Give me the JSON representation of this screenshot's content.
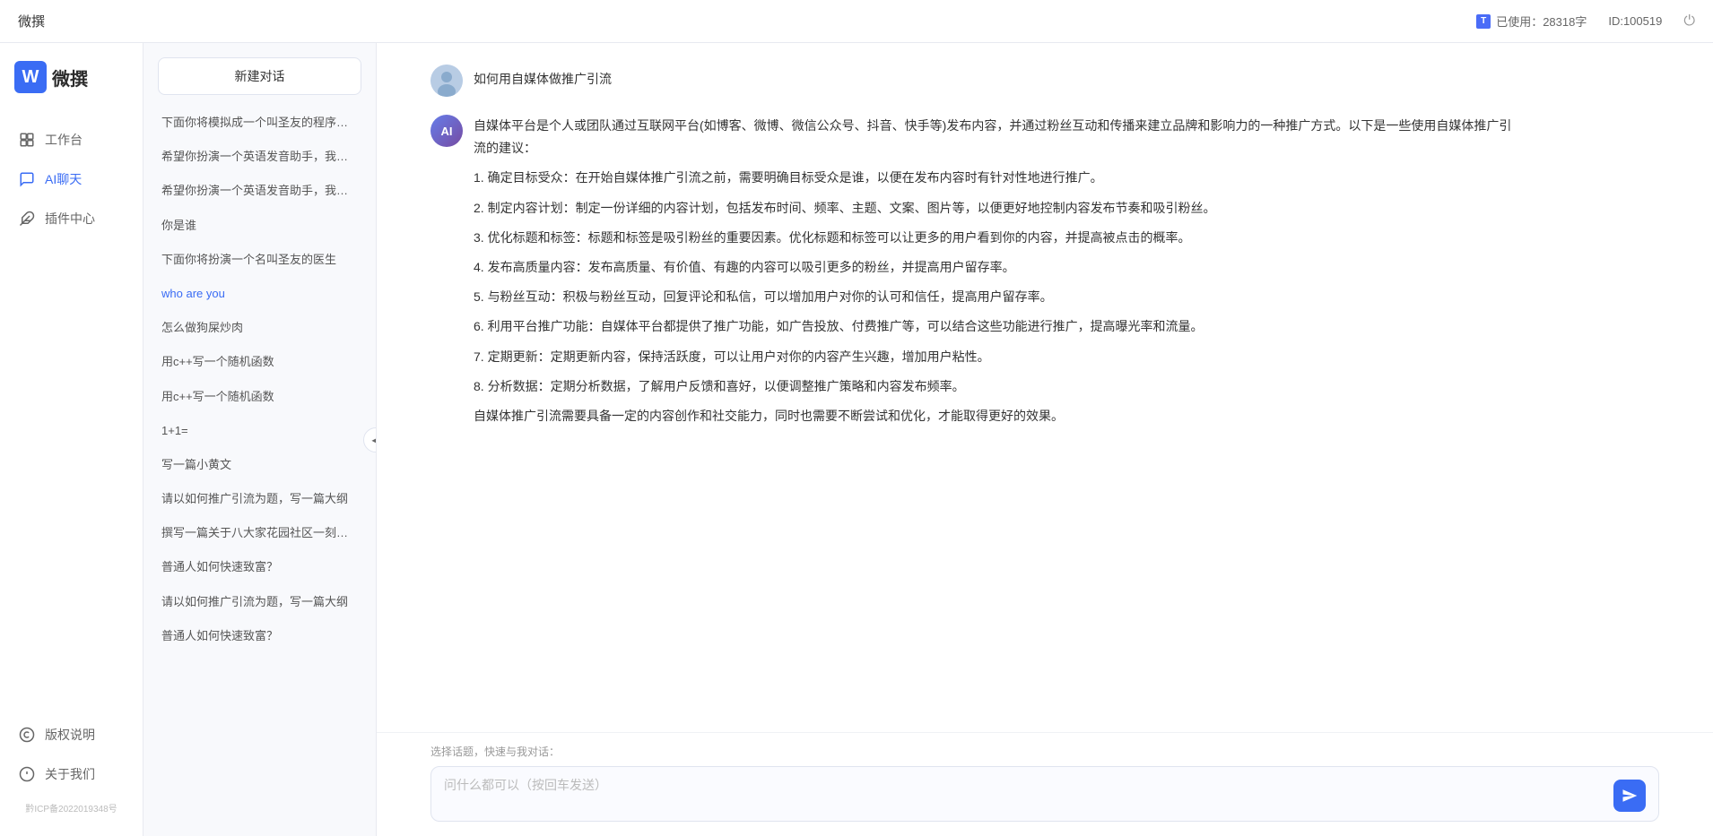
{
  "topbar": {
    "title": "微撰",
    "usage_label": "已使用：28318字",
    "id_label": "ID:100519",
    "usage_icon": "T"
  },
  "sidebar": {
    "logo_text": "微撰",
    "nav_items": [
      {
        "id": "workbench",
        "label": "工作台",
        "icon": "🖥"
      },
      {
        "id": "ai-chat",
        "label": "AI聊天",
        "icon": "💬",
        "active": true
      },
      {
        "id": "plugins",
        "label": "插件中心",
        "icon": "🧩"
      }
    ],
    "bottom_items": [
      {
        "id": "copyright",
        "label": "版权说明",
        "icon": "©"
      },
      {
        "id": "about",
        "label": "关于我们",
        "icon": "ℹ"
      }
    ],
    "icp": "黔ICP备2022019348号"
  },
  "history": {
    "new_chat_label": "新建对话",
    "items": [
      {
        "id": 1,
        "text": "下面你将模拟成一个叫圣友的程序员，我说...",
        "active": false
      },
      {
        "id": 2,
        "text": "希望你扮演一个英语发音助手，我提供给你...",
        "active": false
      },
      {
        "id": 3,
        "text": "希望你扮演一个英语发音助手，我提供给你...",
        "active": false
      },
      {
        "id": 4,
        "text": "你是谁",
        "active": false
      },
      {
        "id": 5,
        "text": "下面你将扮演一个名叫圣友的医生",
        "active": false
      },
      {
        "id": 6,
        "text": "who are you",
        "active": true
      },
      {
        "id": 7,
        "text": "怎么做狗屎炒肉",
        "active": false
      },
      {
        "id": 8,
        "text": "用c++写一个随机函数",
        "active": false
      },
      {
        "id": 9,
        "text": "用c++写一个随机函数",
        "active": false
      },
      {
        "id": 10,
        "text": "1+1=",
        "active": false
      },
      {
        "id": 11,
        "text": "写一篇小黄文",
        "active": false
      },
      {
        "id": 12,
        "text": "请以如何推广引流为题，写一篇大纲",
        "active": false
      },
      {
        "id": 13,
        "text": "撰写一篇关于八大家花园社区一刻钟便民生...",
        "active": false
      },
      {
        "id": 14,
        "text": "普通人如何快速致富？",
        "active": false
      },
      {
        "id": 15,
        "text": "请以如何推广引流为题，写一篇大纲",
        "active": false
      },
      {
        "id": 16,
        "text": "普通人如何快速致富？",
        "active": false
      }
    ]
  },
  "chat": {
    "user_question": "如何用自媒体做推广引流",
    "ai_response": {
      "paragraphs": [
        "自媒体平台是个人或团队通过互联网平台(如博客、微博、微信公众号、抖音、快手等)发布内容，并通过粉丝互动和传播来建立品牌和影响力的一种推广方式。以下是一些使用自媒体推广引流的建议：",
        "1. 确定目标受众：在开始自媒体推广引流之前，需要明确目标受众是谁，以便在发布内容时有针对性地进行推广。",
        "2. 制定内容计划：制定一份详细的内容计划，包括发布时间、频率、主题、文案、图片等，以便更好地控制内容发布节奏和吸引粉丝。",
        "3. 优化标题和标签：标题和标签是吸引粉丝的重要因素。优化标题和标签可以让更多的用户看到你的内容，并提高被点击的概率。",
        "4. 发布高质量内容：发布高质量、有价值、有趣的内容可以吸引更多的粉丝，并提高用户留存率。",
        "5. 与粉丝互动：积极与粉丝互动，回复评论和私信，可以增加用户对你的认可和信任，提高用户留存率。",
        "6. 利用平台推广功能：自媒体平台都提供了推广功能，如广告投放、付费推广等，可以结合这些功能进行推广，提高曝光率和流量。",
        "7. 定期更新：定期更新内容，保持活跃度，可以让用户对你的内容产生兴趣，增加用户粘性。",
        "8. 分析数据：定期分析数据，了解用户反馈和喜好，以便调整推广策略和内容发布频率。",
        "自媒体推广引流需要具备一定的内容创作和社交能力，同时也需要不断尝试和优化，才能取得更好的效果。"
      ]
    },
    "quick_topics_label": "选择话题，快速与我对话：",
    "input_placeholder": "问什么都可以（按回车发送）"
  }
}
